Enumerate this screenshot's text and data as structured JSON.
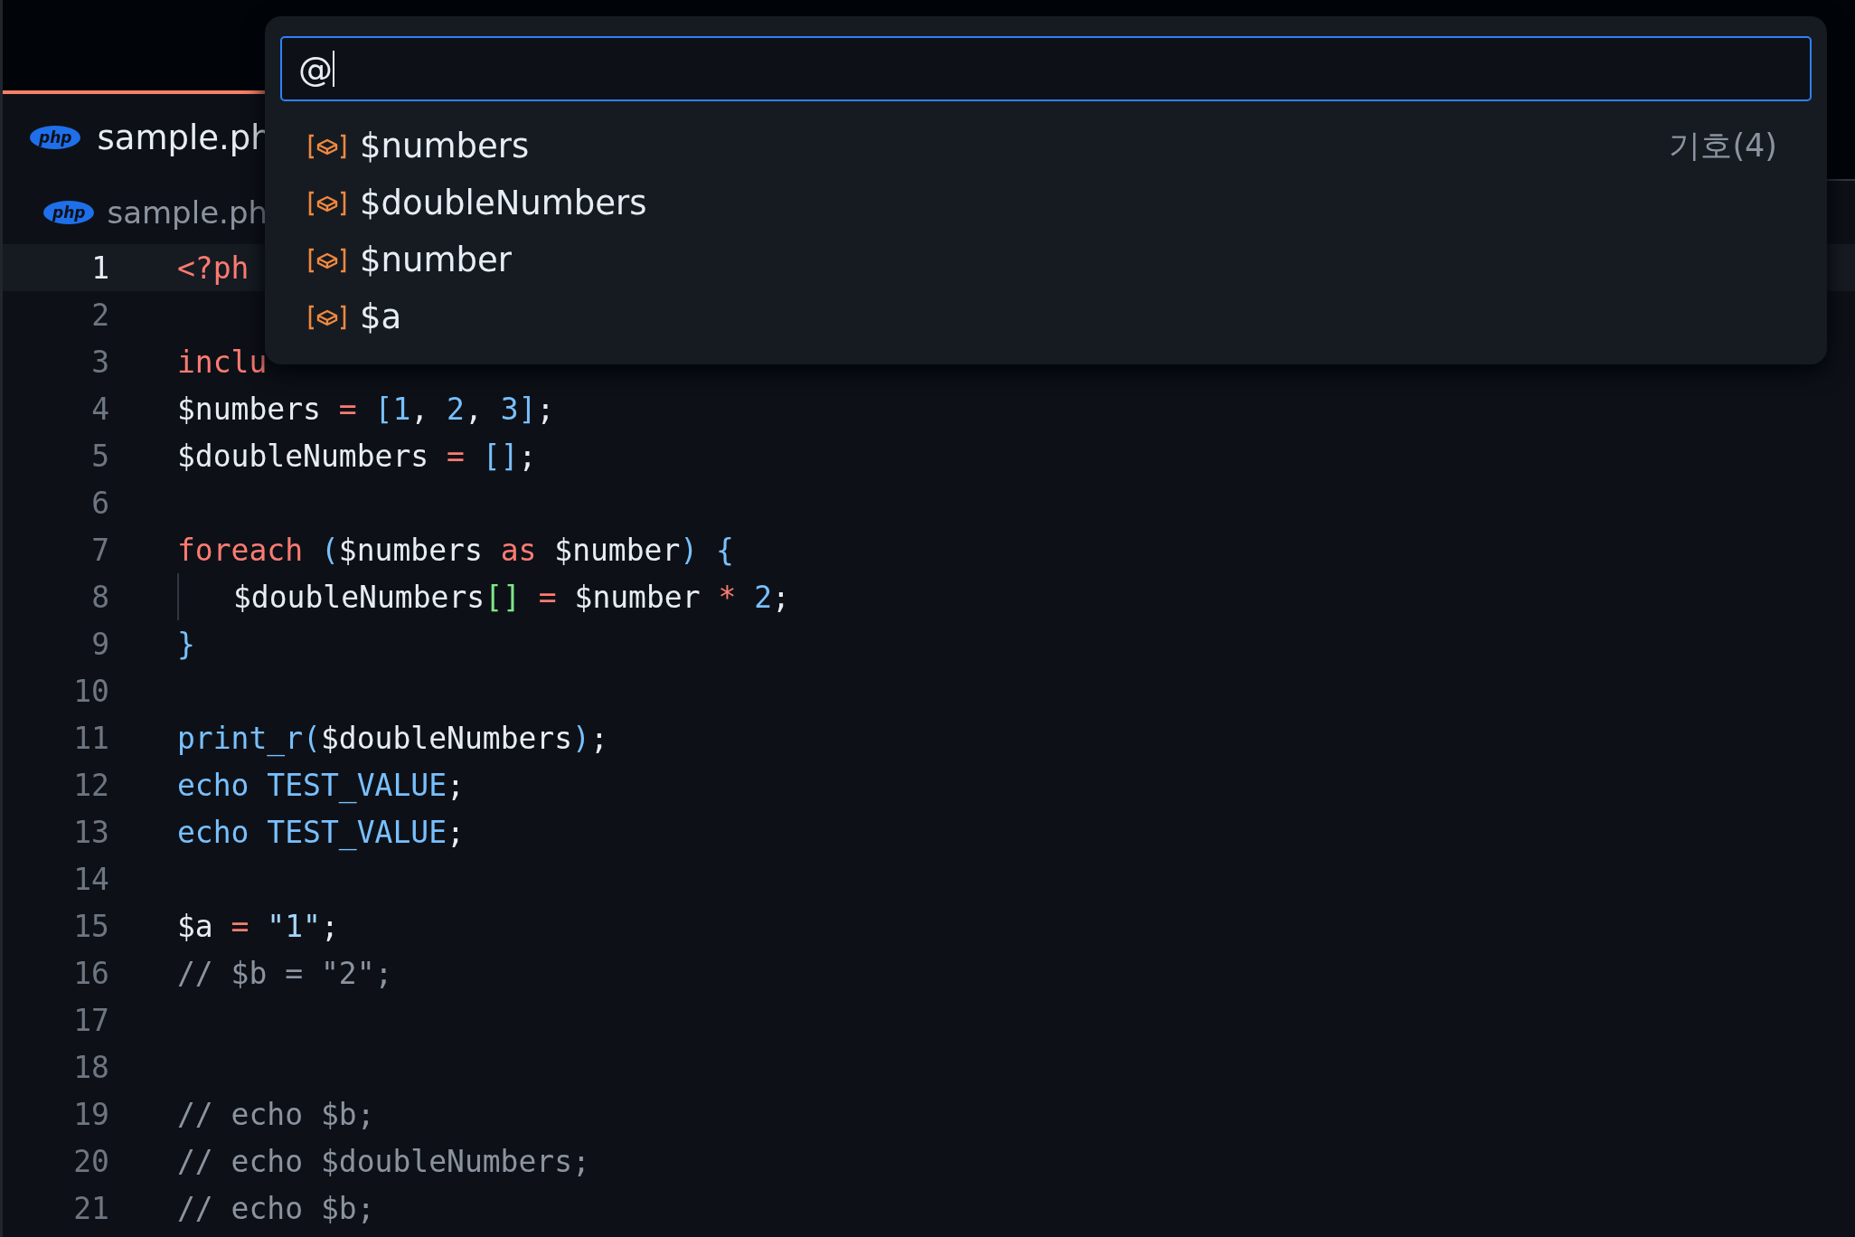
{
  "tab": {
    "icon_text": "php",
    "label": "sample.ph",
    "selected": true
  },
  "breadcrumb": {
    "icon_text": "php",
    "label": "sample.ph"
  },
  "editor": {
    "lines": [
      {
        "number": "1",
        "current": true,
        "tokens": [
          {
            "kind": "keyword",
            "text": "<?ph"
          }
        ]
      },
      {
        "number": "2",
        "current": false
      },
      {
        "number": "3",
        "current": false,
        "tokens": [
          {
            "kind": "keyword",
            "text": "inclu"
          }
        ]
      },
      {
        "number": "4",
        "current": false,
        "tokens": [
          {
            "kind": "plain",
            "text": "$numbers "
          },
          {
            "kind": "keyword",
            "text": "= "
          },
          {
            "kind": "blue",
            "text": "[1"
          },
          {
            "kind": "plain",
            "text": ", "
          },
          {
            "kind": "blue",
            "text": "2"
          },
          {
            "kind": "plain",
            "text": ", "
          },
          {
            "kind": "blue",
            "text": "3]"
          },
          {
            "kind": "plain",
            "text": ";"
          }
        ]
      },
      {
        "number": "5",
        "current": false,
        "tokens": [
          {
            "kind": "plain",
            "text": "$doubleNumbers "
          },
          {
            "kind": "keyword",
            "text": "= "
          },
          {
            "kind": "blue",
            "text": "[]"
          },
          {
            "kind": "plain",
            "text": ";"
          }
        ]
      },
      {
        "number": "6",
        "current": false
      },
      {
        "number": "7",
        "current": false,
        "tokens": [
          {
            "kind": "keyword",
            "text": "foreach "
          },
          {
            "kind": "blue",
            "text": "("
          },
          {
            "kind": "plain",
            "text": "$numbers "
          },
          {
            "kind": "keyword",
            "text": "as"
          },
          {
            "kind": "plain",
            "text": " $number"
          },
          {
            "kind": "blue",
            "text": ") {"
          }
        ],
        "children": [
          {
            "number": "8",
            "current": false,
            "tokens": [
              {
                "kind": "plain",
                "text": "$doubleNumbers"
              },
              {
                "kind": "green",
                "text": "[] "
              },
              {
                "kind": "keyword",
                "text": "="
              },
              {
                "kind": "plain",
                "text": " $number "
              },
              {
                "kind": "keyword",
                "text": "* "
              },
              {
                "kind": "blue",
                "text": "2"
              },
              {
                "kind": "plain",
                "text": ";"
              }
            ]
          }
        ]
      },
      {
        "number": "9",
        "current": false,
        "tokens": [
          {
            "kind": "blue",
            "text": "}"
          }
        ]
      },
      {
        "number": "10",
        "current": false
      },
      {
        "number": "11",
        "current": false,
        "tokens": [
          {
            "kind": "blue",
            "text": "print_r("
          },
          {
            "kind": "plain",
            "text": "$doubleNumbers"
          },
          {
            "kind": "blue",
            "text": ")"
          },
          {
            "kind": "plain",
            "text": ";"
          }
        ]
      },
      {
        "number": "12",
        "current": false,
        "tokens": [
          {
            "kind": "blue",
            "text": "echo TEST_VALUE"
          },
          {
            "kind": "plain",
            "text": ";"
          }
        ]
      },
      {
        "number": "13",
        "current": false,
        "tokens": [
          {
            "kind": "blue",
            "text": "echo TEST_VALUE"
          },
          {
            "kind": "plain",
            "text": ";"
          }
        ]
      },
      {
        "number": "14",
        "current": false
      },
      {
        "number": "15",
        "current": false,
        "tokens": [
          {
            "kind": "plain",
            "text": "$a "
          },
          {
            "kind": "keyword",
            "text": "= "
          },
          {
            "kind": "string",
            "text": "\"1\""
          },
          {
            "kind": "plain",
            "text": ";"
          }
        ]
      },
      {
        "number": "16",
        "current": false,
        "tokens": [
          {
            "kind": "comment",
            "text": "// $b = \"2\";"
          }
        ]
      },
      {
        "number": "17",
        "current": false
      },
      {
        "number": "18",
        "current": false
      },
      {
        "number": "19",
        "current": false,
        "tokens": [
          {
            "kind": "comment",
            "text": "// echo $b;"
          }
        ]
      },
      {
        "number": "20",
        "current": false,
        "tokens": [
          {
            "kind": "comment",
            "text": "// echo $doubleNumbers;"
          }
        ]
      },
      {
        "number": "21",
        "current": false,
        "tokens": [
          {
            "kind": "comment",
            "text": "// echo $b;"
          }
        ]
      }
    ]
  },
  "symbol_picker": {
    "query": "@",
    "group_label": "기호(4)",
    "items": [
      {
        "label": "$numbers",
        "selected": false
      },
      {
        "label": "$doubleNumbers",
        "selected": false
      },
      {
        "label": "$number",
        "selected": false
      },
      {
        "label": "$a",
        "selected": false
      }
    ]
  }
}
